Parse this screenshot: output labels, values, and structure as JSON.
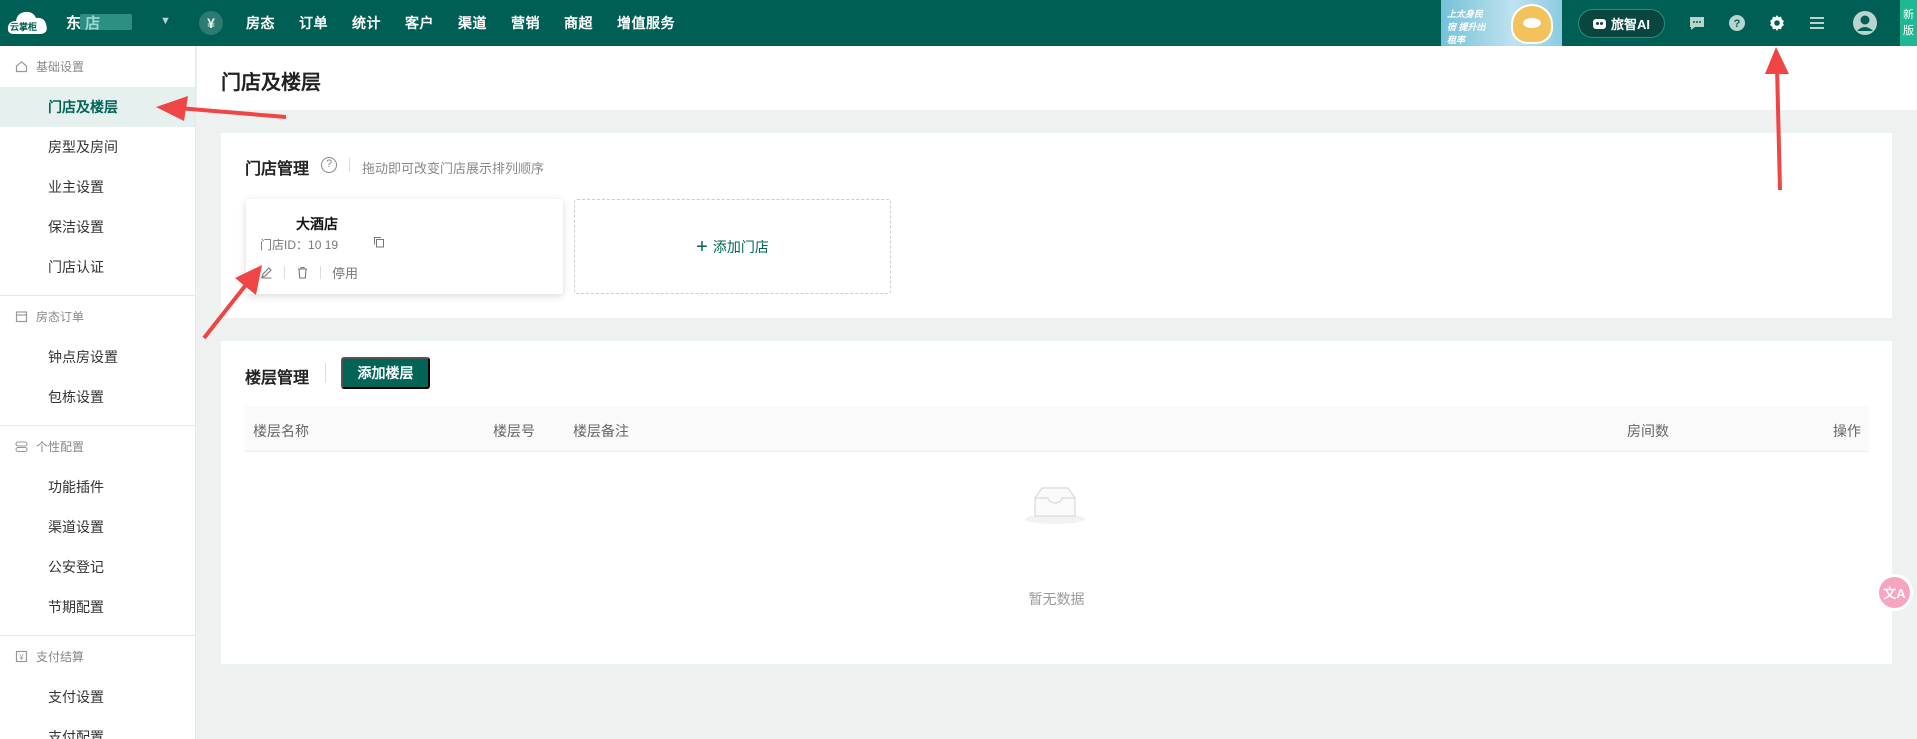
{
  "topbar": {
    "logo_text": "云掌柜",
    "store_name": "东   店",
    "yen_symbol": "¥",
    "nav": [
      "房态",
      "订单",
      "统计",
      "客户",
      "渠道",
      "营销",
      "商超",
      "增值服务"
    ],
    "promo_text": "上太身民宿 提升出租率",
    "ai_label": "旅智AI",
    "new_version": "新版"
  },
  "sidebar": {
    "groups": [
      {
        "title": "基础设置",
        "icon": "home-icon",
        "items": [
          "门店及楼层",
          "房型及房间",
          "业主设置",
          "保洁设置",
          "门店认证"
        ]
      },
      {
        "title": "房态订单",
        "icon": "calendar-icon",
        "items": [
          "钟点房设置",
          "包栋设置"
        ]
      },
      {
        "title": "个性配置",
        "icon": "toggle-icon",
        "items": [
          "功能插件",
          "渠道设置",
          "公安登记",
          "节期配置"
        ]
      },
      {
        "title": "支付结算",
        "icon": "payment-icon",
        "items": [
          "支付设置",
          "支付配置"
        ]
      }
    ],
    "active_item": "门店及楼层"
  },
  "page": {
    "title": "门店及楼层"
  },
  "store_section": {
    "title": "门店管理",
    "hint": "拖动即可改变门店展示排列顺序",
    "store": {
      "name": "大酒店",
      "id_label": "门店ID：",
      "id_value": "10   19",
      "disable_label": "停用"
    },
    "add_store_label": "添加门店"
  },
  "floor_section": {
    "title": "楼层管理",
    "add_floor_label": "添加楼层",
    "columns": [
      "楼层名称",
      "楼层号",
      "楼层备注",
      "房间数",
      "操作"
    ],
    "rows": [],
    "empty_text": "暂无数据"
  },
  "float_button": "文A",
  "colors": {
    "topbar": "#005f55",
    "accent": "#006456",
    "annotation_arrow": "#f04545"
  }
}
